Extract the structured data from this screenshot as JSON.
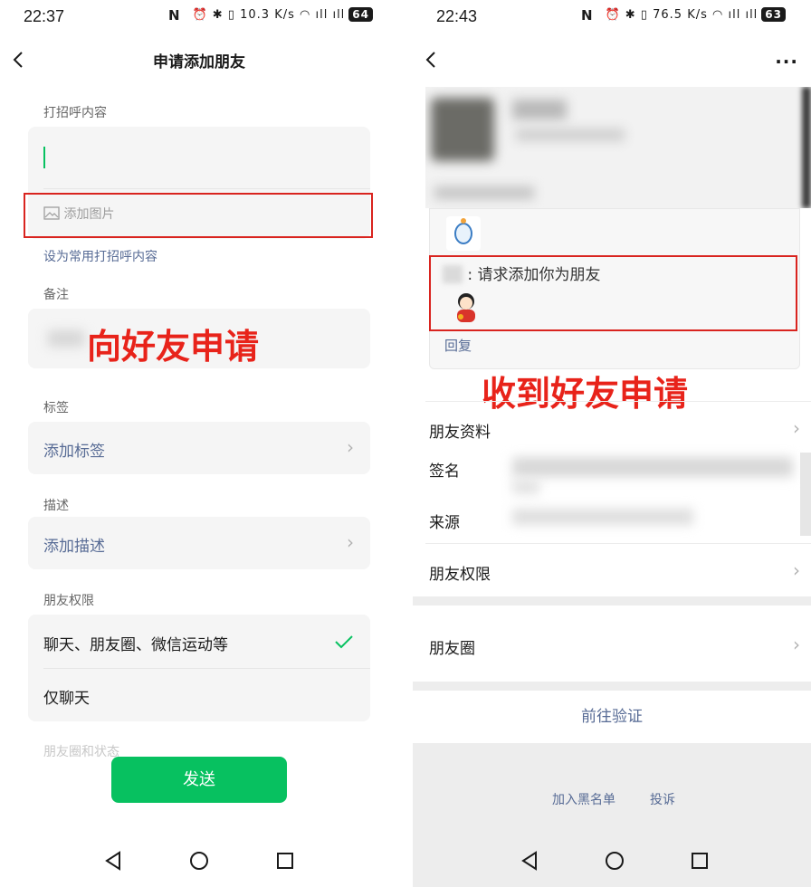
{
  "left": {
    "status": {
      "time": "22:37",
      "speed_top": "10.3",
      "speed_bottom": "K/s",
      "battery": "64"
    },
    "title": "申请添加朋友",
    "greeting_label": "打招呼内容",
    "add_image": "添加图片",
    "set_common": "设为常用打招呼内容",
    "remark_label": "备注",
    "overlay": "向好友申请",
    "tag_label": "标签",
    "add_tag": "添加标签",
    "desc_label": "描述",
    "add_desc": "添加描述",
    "perm_label": "朋友权限",
    "perm_option_1": "聊天、朋友圈、微信运动等",
    "perm_option_2": "仅聊天",
    "moments_status_label": "朋友圈和状态",
    "send": "发送"
  },
  "right": {
    "status": {
      "time": "22:43",
      "speed_top": "76.5",
      "speed_bottom": "K/s",
      "battery": "63"
    },
    "request_text": "请求添加你为朋友",
    "request_separator": ":",
    "reply": "回复",
    "overlay": "收到好友申请",
    "rows": {
      "profile": "朋友资料",
      "signature": "签名",
      "source": "来源",
      "permissions": "朋友权限",
      "moments": "朋友圈"
    },
    "verify": "前往验证",
    "blacklist": "加入黑名单",
    "report": "投诉"
  },
  "colors": {
    "accent_green": "#07c160",
    "link_blue": "#576b95",
    "highlight_red": "#d9241f"
  },
  "icons": [
    "back-arrow-icon",
    "more-icon",
    "image-icon",
    "chevron-right-icon",
    "check-icon",
    "nav-back-icon",
    "nav-home-icon",
    "nav-recents-icon"
  ]
}
